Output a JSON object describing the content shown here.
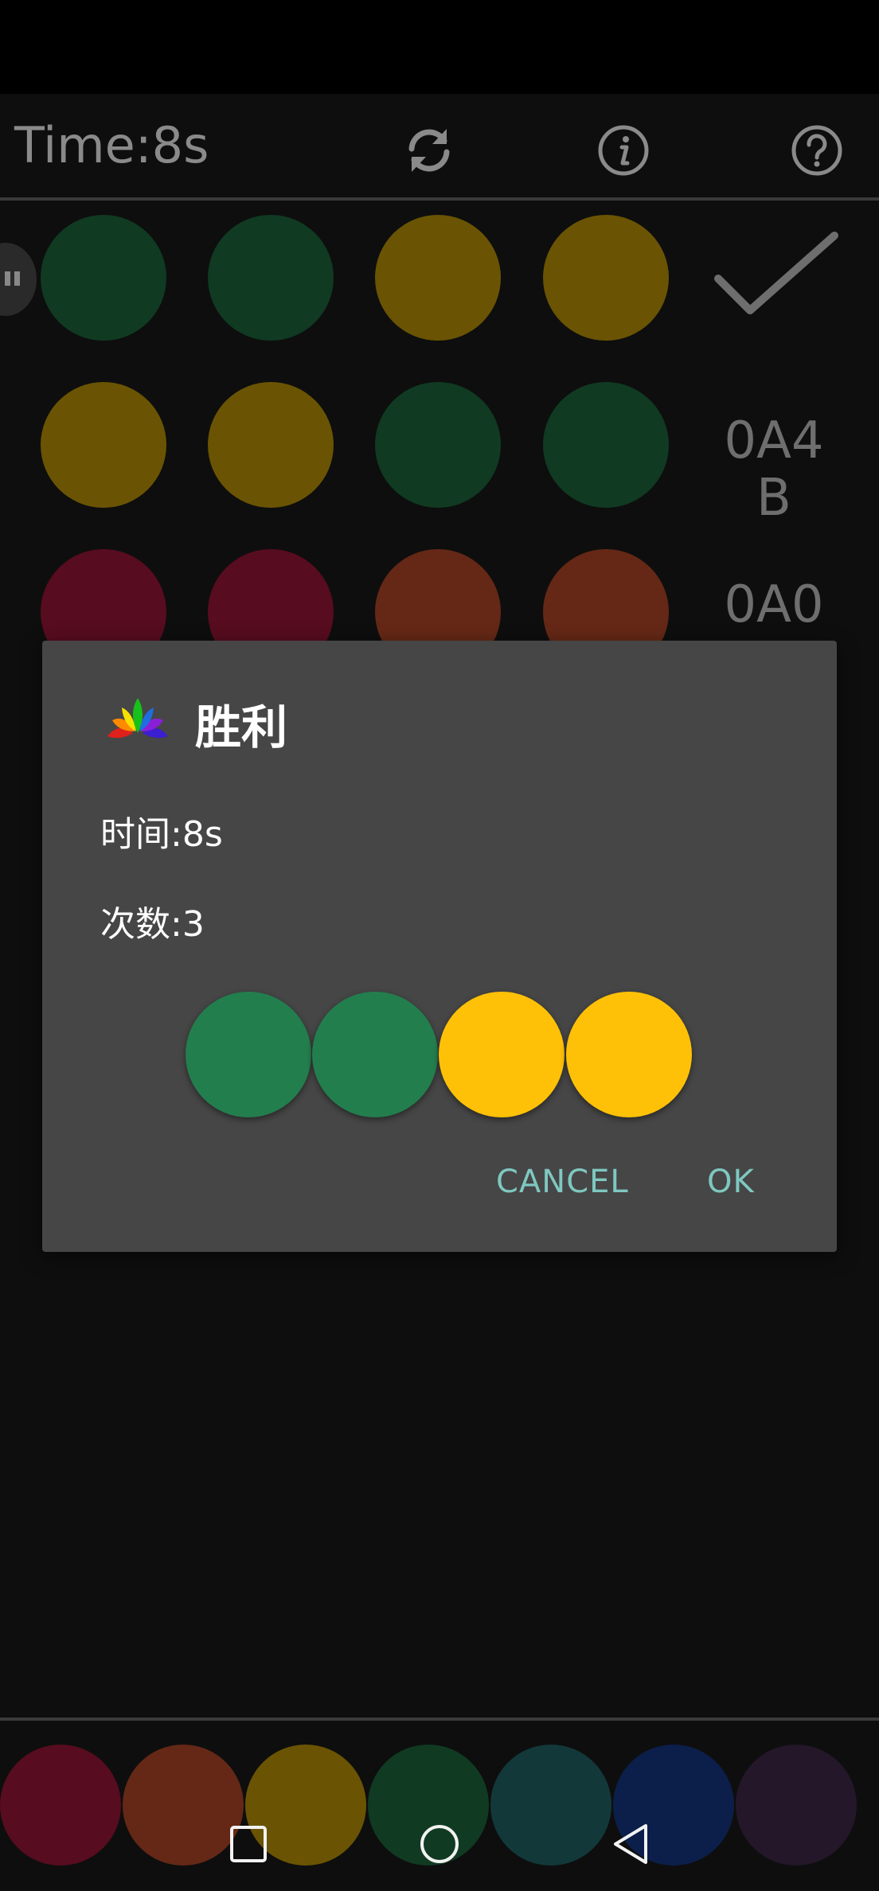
{
  "header": {
    "time_label": "Time:8s",
    "icons": [
      "refresh-icon",
      "info-icon",
      "help-icon"
    ]
  },
  "colors": {
    "background": "#0e0e0e",
    "dark_green": "#103a22",
    "dark_yellow": "#6a5403",
    "dark_red": "#570c1f",
    "dark_orange": "#652816",
    "dark_teal": "#12383a",
    "dark_blue": "#0c1f4a",
    "dark_purple": "#231729",
    "bright_green": "#237e4e",
    "bright_yellow": "#ffc107",
    "dialog_bg": "#464646",
    "accent": "#7ec8c0"
  },
  "board": {
    "rows": [
      {
        "pegs": [
          "green",
          "green",
          "yellow",
          "yellow"
        ],
        "feedback": "check-icon"
      },
      {
        "pegs": [
          "yellow",
          "yellow",
          "green",
          "green"
        ],
        "feedback": "0A4B"
      },
      {
        "pegs": [
          "red",
          "red",
          "orange",
          "orange"
        ],
        "feedback": "0A0"
      }
    ]
  },
  "dialog": {
    "title": "胜利",
    "time_line": "时间:8s",
    "count_line": "次数:3",
    "answer": [
      "green",
      "green",
      "yellow",
      "yellow"
    ],
    "cancel_label": "CANCEL",
    "ok_label": "OK"
  },
  "palette": [
    "red",
    "orange",
    "yellow",
    "green",
    "teal",
    "blue",
    "purple"
  ],
  "navbar": {
    "icons": [
      "recent-apps-icon",
      "home-icon",
      "back-icon"
    ]
  }
}
